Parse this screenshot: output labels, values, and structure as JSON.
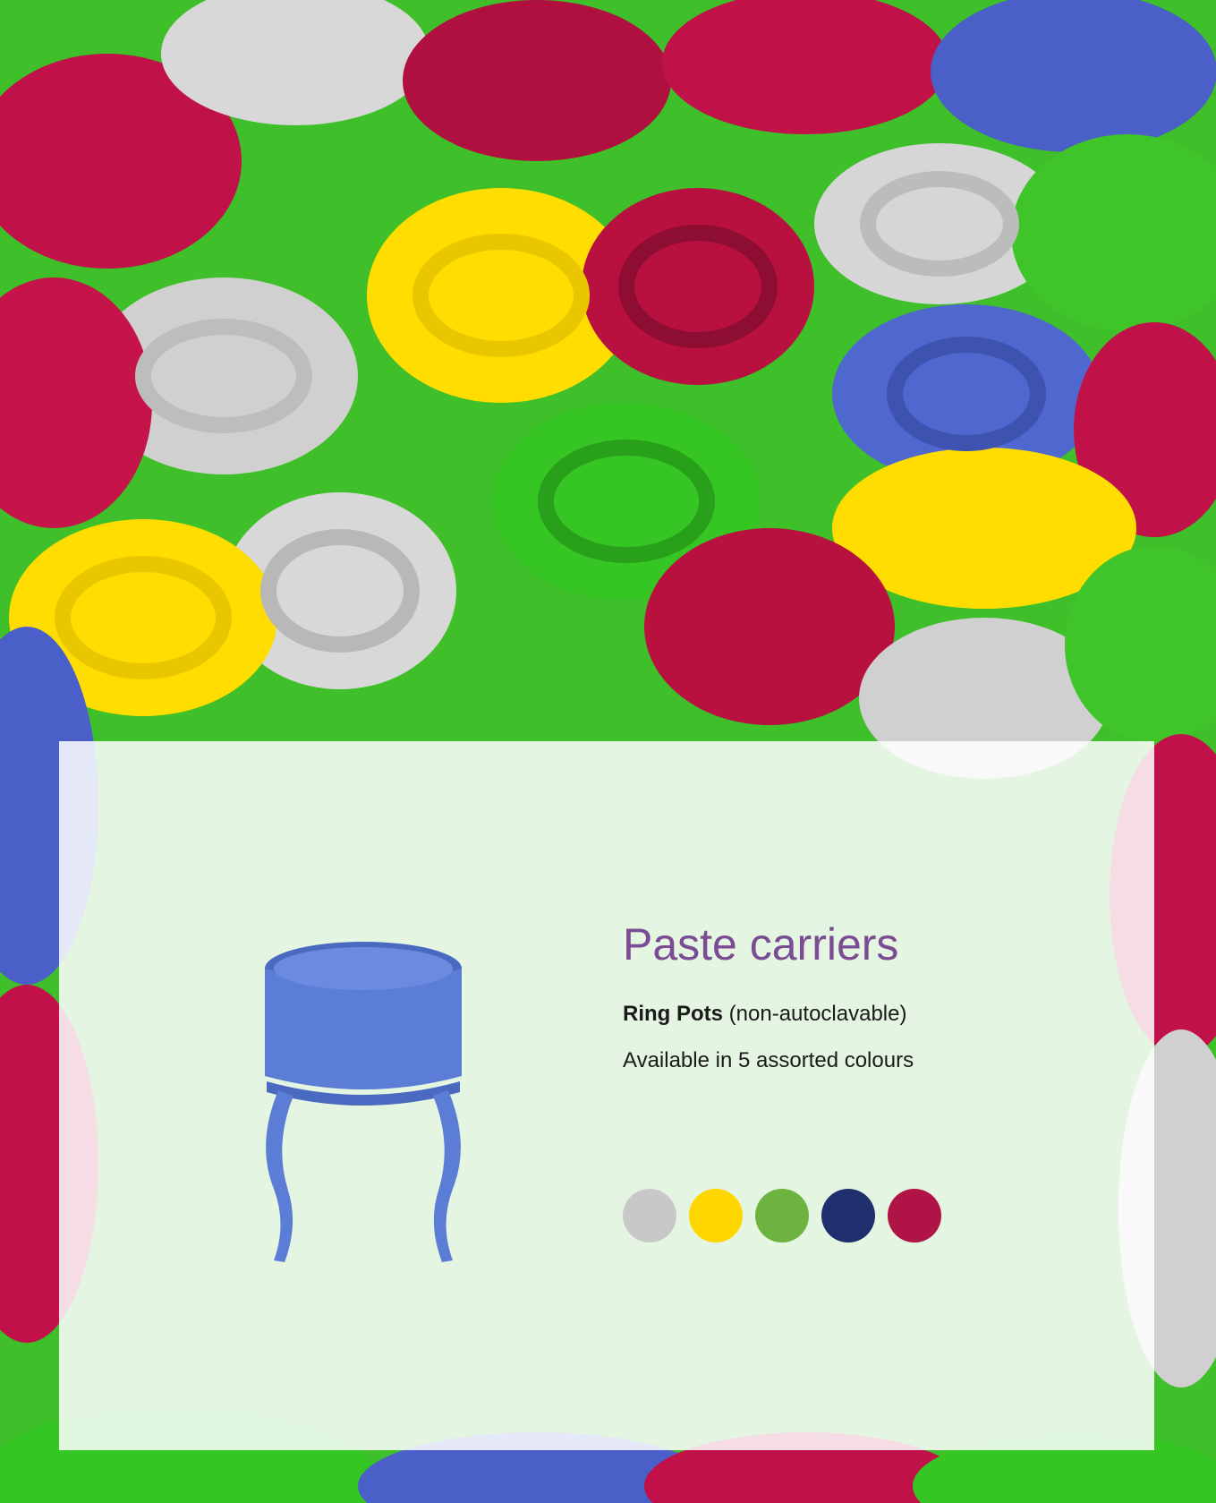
{
  "page": {
    "background_description_icon": "colourful-ring-pots-photo",
    "title": "Paste carriers",
    "product": {
      "name": "Ring Pots",
      "qualifier": "(non-autoclavable)"
    },
    "availability": "Available in 5 assorted colours",
    "product_image_icon": "blue-ring-pot-icon",
    "swatches": [
      {
        "name": "grey",
        "color": "#c8c8c8"
      },
      {
        "name": "yellow",
        "color": "#ffd700"
      },
      {
        "name": "green",
        "color": "#6db33f"
      },
      {
        "name": "navy",
        "color": "#1f2f6e"
      },
      {
        "name": "crimson",
        "color": "#b01446"
      }
    ],
    "colors": {
      "title": "#7b4b94",
      "ring_blue": "#5b7dd6",
      "ring_blue_dark": "#4a69c0"
    }
  }
}
